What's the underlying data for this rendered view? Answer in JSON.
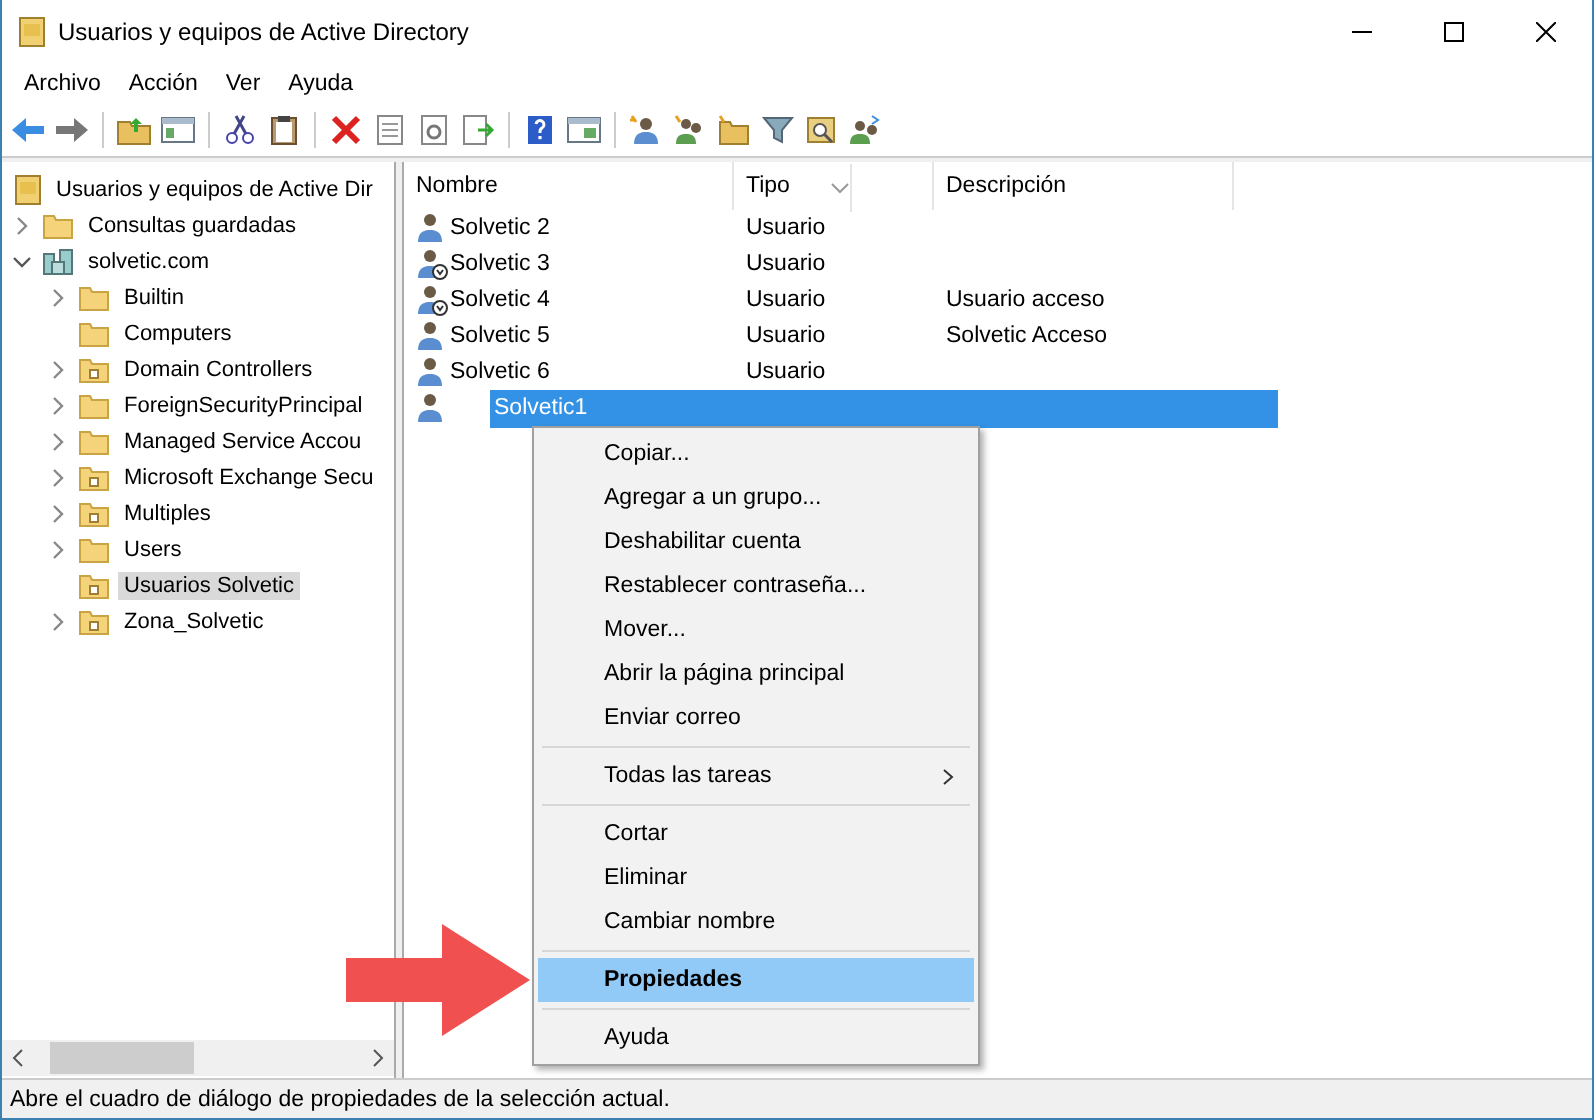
{
  "window": {
    "title": "Usuarios y equipos de Active Directory"
  },
  "menu_bar": [
    "Archivo",
    "Acción",
    "Ver",
    "Ayuda"
  ],
  "tree": [
    {
      "label": "Usuarios y equipos de Active Dir",
      "kind": "root",
      "expandable": false,
      "selected": false,
      "children": [
        {
          "label": "Consultas guardadas",
          "kind": "folder",
          "expandable": true,
          "expanded": false,
          "selected": false
        },
        {
          "label": "solvetic.com",
          "kind": "domain",
          "expandable": true,
          "expanded": true,
          "selected": false,
          "children": [
            {
              "label": "Builtin",
              "kind": "folder",
              "expandable": true,
              "expanded": false,
              "selected": false
            },
            {
              "label": "Computers",
              "kind": "folder",
              "expandable": false,
              "selected": false
            },
            {
              "label": "Domain Controllers",
              "kind": "ou",
              "expandable": true,
              "expanded": false,
              "selected": false
            },
            {
              "label": "ForeignSecurityPrincipal",
              "kind": "folder",
              "expandable": true,
              "expanded": false,
              "selected": false
            },
            {
              "label": "Managed Service Accou",
              "kind": "folder",
              "expandable": true,
              "expanded": false,
              "selected": false
            },
            {
              "label": "Microsoft Exchange Secu",
              "kind": "ou",
              "expandable": true,
              "expanded": false,
              "selected": false
            },
            {
              "label": "Multiples",
              "kind": "ou",
              "expandable": true,
              "expanded": false,
              "selected": false
            },
            {
              "label": "Users",
              "kind": "folder",
              "expandable": true,
              "expanded": false,
              "selected": false
            },
            {
              "label": "Usuarios Solvetic",
              "kind": "ou",
              "expandable": false,
              "selected": true
            },
            {
              "label": "Zona_Solvetic",
              "kind": "ou",
              "expandable": true,
              "expanded": false,
              "selected": false
            }
          ]
        }
      ]
    }
  ],
  "list": {
    "columns": [
      "Nombre",
      "Tipo",
      "Descripción"
    ],
    "rows": [
      {
        "name": "Solvetic 2",
        "type": "Usuario",
        "description": "",
        "disabled": false,
        "selected": false
      },
      {
        "name": "Solvetic 3",
        "type": "Usuario",
        "description": "",
        "disabled": true,
        "selected": false
      },
      {
        "name": "Solvetic 4",
        "type": "Usuario",
        "description": "Usuario acceso",
        "disabled": true,
        "selected": false
      },
      {
        "name": "Solvetic 5",
        "type": "Usuario",
        "description": "Solvetic Acceso",
        "disabled": false,
        "selected": false
      },
      {
        "name": "Solvetic 6",
        "type": "Usuario",
        "description": "",
        "disabled": false,
        "selected": false
      },
      {
        "name": "Solvetic1",
        "type": "",
        "description": "",
        "disabled": false,
        "selected": true
      }
    ]
  },
  "context_menu": [
    [
      {
        "label": "Copiar...",
        "submenu": false,
        "selected": false
      },
      {
        "label": "Agregar a un grupo...",
        "submenu": false,
        "selected": false
      },
      {
        "label": "Deshabilitar cuenta",
        "submenu": false,
        "selected": false
      },
      {
        "label": "Restablecer contraseña...",
        "submenu": false,
        "selected": false
      },
      {
        "label": "Mover...",
        "submenu": false,
        "selected": false
      },
      {
        "label": "Abrir la página principal",
        "submenu": false,
        "selected": false
      },
      {
        "label": "Enviar correo",
        "submenu": false,
        "selected": false
      }
    ],
    [
      {
        "label": "Todas las tareas",
        "submenu": true,
        "selected": false
      }
    ],
    [
      {
        "label": "Cortar",
        "submenu": false,
        "selected": false
      },
      {
        "label": "Eliminar",
        "submenu": false,
        "selected": false
      },
      {
        "label": "Cambiar nombre",
        "submenu": false,
        "selected": false
      }
    ],
    [
      {
        "label": "Propiedades",
        "submenu": false,
        "selected": true
      }
    ],
    [
      {
        "label": "Ayuda",
        "submenu": false,
        "selected": false
      }
    ]
  ],
  "status_bar": "Abre el cuadro de diálogo de propiedades de la selección actual."
}
